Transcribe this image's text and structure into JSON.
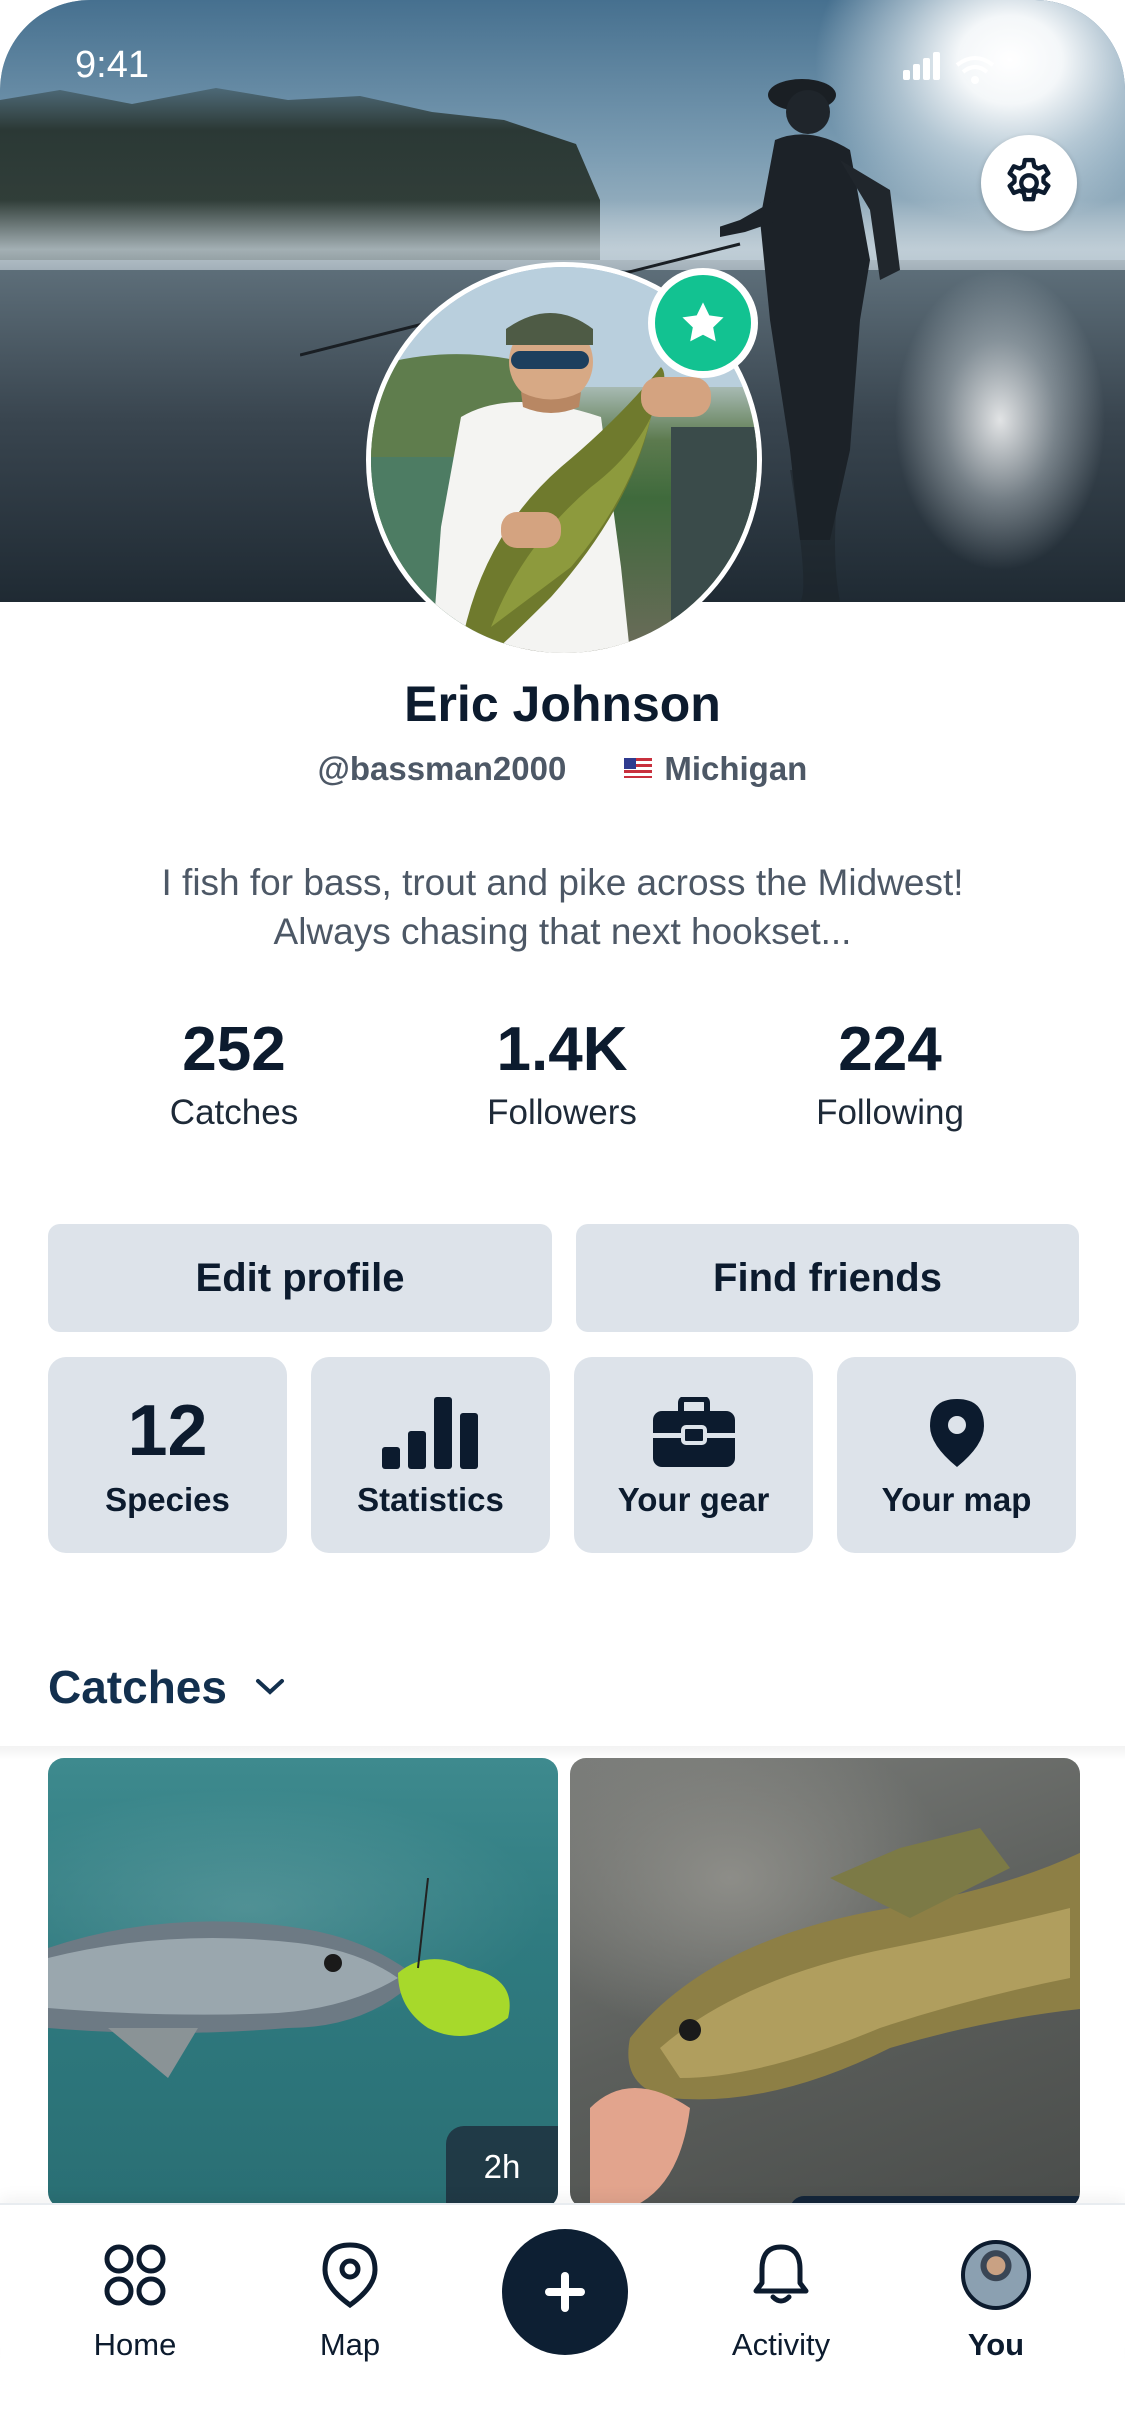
{
  "status_bar": {
    "time": "9:41"
  },
  "profile": {
    "name": "Eric Johnson",
    "handle": "@bassman2000",
    "location": "Michigan",
    "bio_line1": "I fish for bass, trout and pike across the Midwest!",
    "bio_line2": "Always chasing that next hookset..."
  },
  "stats": [
    {
      "value": "252",
      "label": "Catches"
    },
    {
      "value": "1.4K",
      "label": "Followers"
    },
    {
      "value": "224",
      "label": "Following"
    }
  ],
  "actions": {
    "edit_profile": "Edit profile",
    "find_friends": "Find friends"
  },
  "tiles": {
    "species_count": "12",
    "species_label": "Species",
    "statistics_label": "Statistics",
    "gear_label": "Your gear",
    "map_label": "Your map"
  },
  "catches_section": {
    "title": "Catches"
  },
  "catches": [
    {
      "time": "2h"
    }
  ],
  "tabbar": {
    "home": "Home",
    "map": "Map",
    "activity": "Activity",
    "you": "You"
  },
  "colors": {
    "primary_text": "#0c1b2e",
    "button_bg": "#dde3ea",
    "badge_green": "#12c291",
    "add_button": "#0d1f33"
  },
  "icons": [
    "gear-icon",
    "star-icon",
    "bar-chart-icon",
    "toolbox-icon",
    "map-pin-icon",
    "chevron-down-icon",
    "home-grid-icon",
    "plus-icon",
    "bell-icon"
  ]
}
